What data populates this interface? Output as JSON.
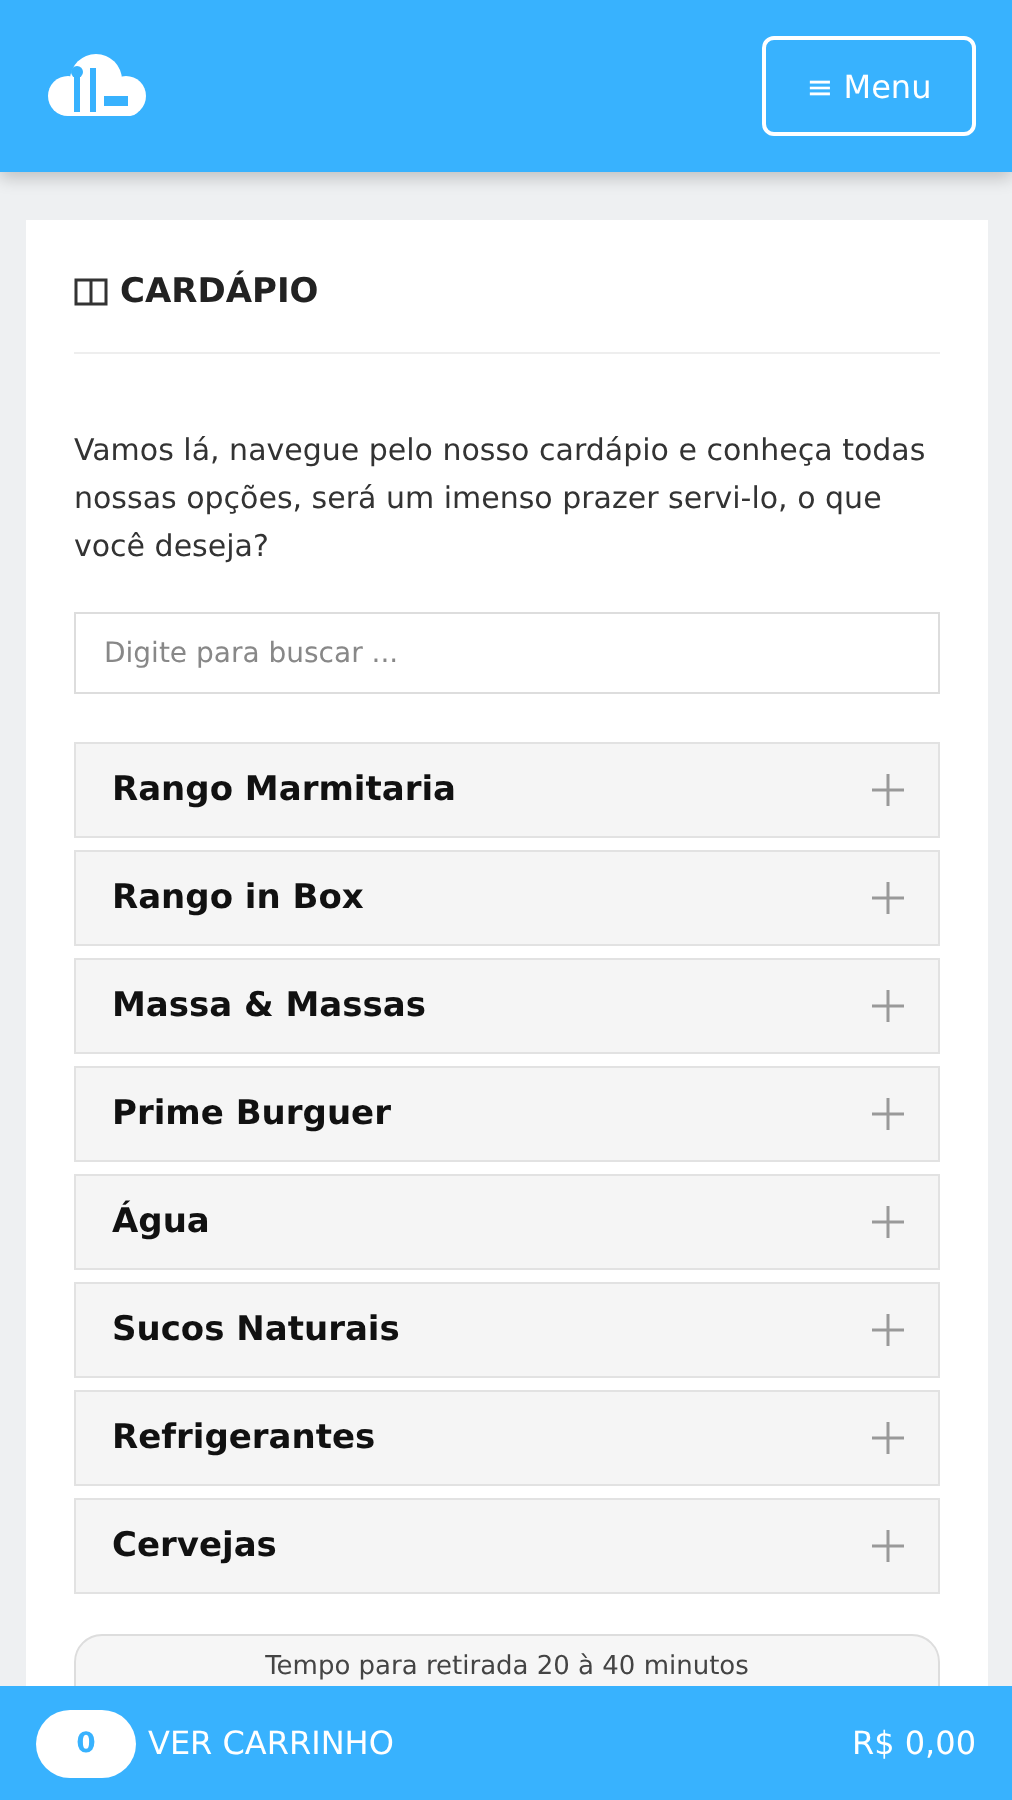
{
  "header": {
    "menu_button": {
      "icon": "≡",
      "label": "Menu"
    }
  },
  "section": {
    "title": "CARDÁPIO",
    "intro": "Vamos lá, navegue pelo nosso cardápio e conheça todas nossas opções, será um imenso prazer servi-lo, o que você deseja?"
  },
  "search": {
    "placeholder": "Digite para buscar ..."
  },
  "categories": [
    {
      "label": "Rango Marmitaria",
      "expanded": false
    },
    {
      "label": "Rango in Box",
      "expanded": false
    },
    {
      "label": "Massa & Massas",
      "expanded": false
    },
    {
      "label": "Prime Burguer",
      "expanded": false
    },
    {
      "label": "Água",
      "expanded": false
    },
    {
      "label": "Sucos Naturais",
      "expanded": false
    },
    {
      "label": "Refrigerantes",
      "expanded": false
    },
    {
      "label": "Cervejas",
      "expanded": false
    }
  ],
  "pickup_notice": "Tempo para retirada 20 à 40 minutos",
  "cart_bar": {
    "count": "0",
    "label": "VER CARRINHO",
    "total": "R$ 0,00"
  }
}
